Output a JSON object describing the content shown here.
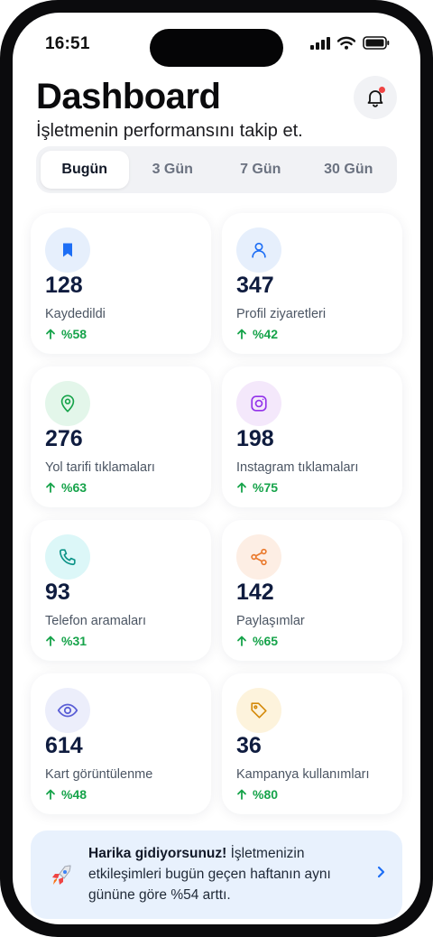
{
  "status_bar": {
    "time": "16:51"
  },
  "header": {
    "title": "Dashboard",
    "subtitle": "İşletmenin performansını takip et."
  },
  "tabs": [
    {
      "label": "Bugün",
      "active": true
    },
    {
      "label": "3 Gün",
      "active": false
    },
    {
      "label": "7 Gün",
      "active": false
    },
    {
      "label": "30 Gün",
      "active": false
    }
  ],
  "cards": [
    {
      "value": "128",
      "label": "Kaydedildi",
      "change": "%58",
      "icon": "bookmark-icon",
      "icon_bg": "#e6effc",
      "icon_color": "#1d6ef5"
    },
    {
      "value": "347",
      "label": "Profil ziyaretleri",
      "change": "%42",
      "icon": "user-icon",
      "icon_bg": "#e6effc",
      "icon_color": "#1d6ef5"
    },
    {
      "value": "276",
      "label": "Yol tarifi tıklamaları",
      "change": "%63",
      "icon": "map-pin-icon",
      "icon_bg": "#e3f6ea",
      "icon_color": "#16a34a"
    },
    {
      "value": "198",
      "label": "Instagram tıklamaları",
      "change": "%75",
      "icon": "instagram-icon",
      "icon_bg": "#f4e8fb",
      "icon_color": "#9333ea"
    },
    {
      "value": "93",
      "label": "Telefon aramaları",
      "change": "%31",
      "icon": "phone-icon",
      "icon_bg": "#dcf7f8",
      "icon_color": "#0d9488"
    },
    {
      "value": "142",
      "label": "Paylaşımlar",
      "change": "%65",
      "icon": "share-icon",
      "icon_bg": "#fdeee4",
      "icon_color": "#ea7a2e"
    },
    {
      "value": "614",
      "label": "Kart görüntülenme",
      "change": "%48",
      "icon": "eye-icon",
      "icon_bg": "#eceefb",
      "icon_color": "#5b5fd6"
    },
    {
      "value": "36",
      "label": "Kampanya kullanımları",
      "change": "%80",
      "icon": "tag-icon",
      "icon_bg": "#fdf3dc",
      "icon_color": "#d48a0b"
    }
  ],
  "banner": {
    "icon": "rocket-icon",
    "bold": "Harika gidiyorsunuz!",
    "text": " İşletmenizin etkileşimleri bugün geçen haftanın aynı gününe göre %54 arttı."
  },
  "colors": {
    "positive": "#16a34a",
    "accent": "#1d6ef5",
    "notification_dot": "#ef4444"
  }
}
